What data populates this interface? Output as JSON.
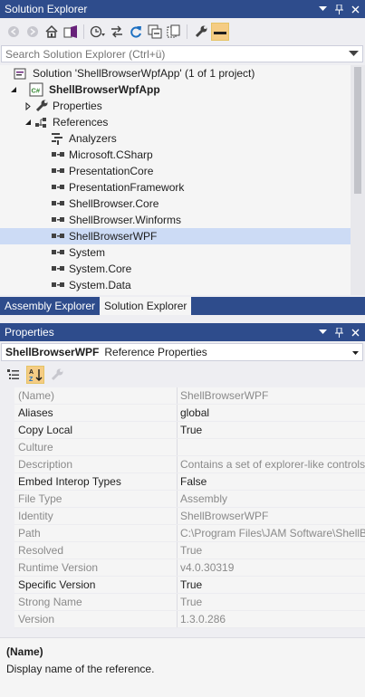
{
  "solution_explorer": {
    "title": "Solution Explorer",
    "search_placeholder": "Search Solution Explorer (Ctrl+ü)",
    "tree": [
      {
        "label": "Solution 'ShellBrowserWpfApp' (1 of 1 project)",
        "icon": "solution-icon",
        "depth": 0,
        "expander": "none",
        "bold": false
      },
      {
        "label": "ShellBrowserWpfApp",
        "icon": "csharp-project-icon",
        "depth": 0,
        "expander": "expanded",
        "bold": true
      },
      {
        "label": "Properties",
        "icon": "wrench-icon",
        "depth": 1,
        "expander": "collapsed",
        "bold": false
      },
      {
        "label": "References",
        "icon": "references-icon",
        "depth": 1,
        "expander": "expanded",
        "bold": false
      },
      {
        "label": "Analyzers",
        "icon": "analyzers-icon",
        "depth": 2,
        "expander": "none",
        "bold": false
      },
      {
        "label": "Microsoft.CSharp",
        "icon": "assembly-reference-icon",
        "depth": 2,
        "expander": "none",
        "bold": false
      },
      {
        "label": "PresentationCore",
        "icon": "assembly-reference-icon",
        "depth": 2,
        "expander": "none",
        "bold": false
      },
      {
        "label": "PresentationFramework",
        "icon": "assembly-reference-icon",
        "depth": 2,
        "expander": "none",
        "bold": false
      },
      {
        "label": "ShellBrowser.Core",
        "icon": "assembly-reference-icon",
        "depth": 2,
        "expander": "none",
        "bold": false
      },
      {
        "label": "ShellBrowser.Winforms",
        "icon": "assembly-reference-icon",
        "depth": 2,
        "expander": "none",
        "bold": false
      },
      {
        "label": "ShellBrowserWPF",
        "icon": "assembly-reference-icon",
        "depth": 2,
        "expander": "none",
        "bold": false,
        "selected": true
      },
      {
        "label": "System",
        "icon": "assembly-reference-icon",
        "depth": 2,
        "expander": "none",
        "bold": false
      },
      {
        "label": "System.Core",
        "icon": "assembly-reference-icon",
        "depth": 2,
        "expander": "none",
        "bold": false
      },
      {
        "label": "System.Data",
        "icon": "assembly-reference-icon",
        "depth": 2,
        "expander": "none",
        "bold": false
      }
    ],
    "tabs": [
      {
        "label": "Assembly Explorer",
        "active": false
      },
      {
        "label": "Solution Explorer",
        "active": true
      }
    ]
  },
  "properties": {
    "title": "Properties",
    "object_name": "ShellBrowserWPF",
    "object_type": "Reference Properties",
    "rows": [
      {
        "name": "(Name)",
        "value": "ShellBrowserWPF",
        "readonly": true
      },
      {
        "name": "Aliases",
        "value": "global",
        "readonly": false
      },
      {
        "name": "Copy Local",
        "value": "True",
        "readonly": false
      },
      {
        "name": "Culture",
        "value": "",
        "readonly": true
      },
      {
        "name": "Description",
        "value": "Contains a set of explorer-like controls",
        "readonly": true
      },
      {
        "name": "Embed Interop Types",
        "value": "False",
        "readonly": false
      },
      {
        "name": "File Type",
        "value": "Assembly",
        "readonly": true
      },
      {
        "name": "Identity",
        "value": "ShellBrowserWPF",
        "readonly": true
      },
      {
        "name": "Path",
        "value": "C:\\Program Files\\JAM Software\\ShellBrowser",
        "readonly": true
      },
      {
        "name": "Resolved",
        "value": "True",
        "readonly": true
      },
      {
        "name": "Runtime Version",
        "value": "v4.0.30319",
        "readonly": true
      },
      {
        "name": "Specific Version",
        "value": "True",
        "readonly": false
      },
      {
        "name": "Strong Name",
        "value": "True",
        "readonly": true
      },
      {
        "name": "Version",
        "value": "1.3.0.286",
        "readonly": true
      }
    ],
    "description_title": "(Name)",
    "description_text": "Display name of the reference."
  },
  "colors": {
    "title_bar": "#2e4c8c",
    "selection": "#ccdbf5",
    "readonly_text": "#8a8a8a"
  }
}
